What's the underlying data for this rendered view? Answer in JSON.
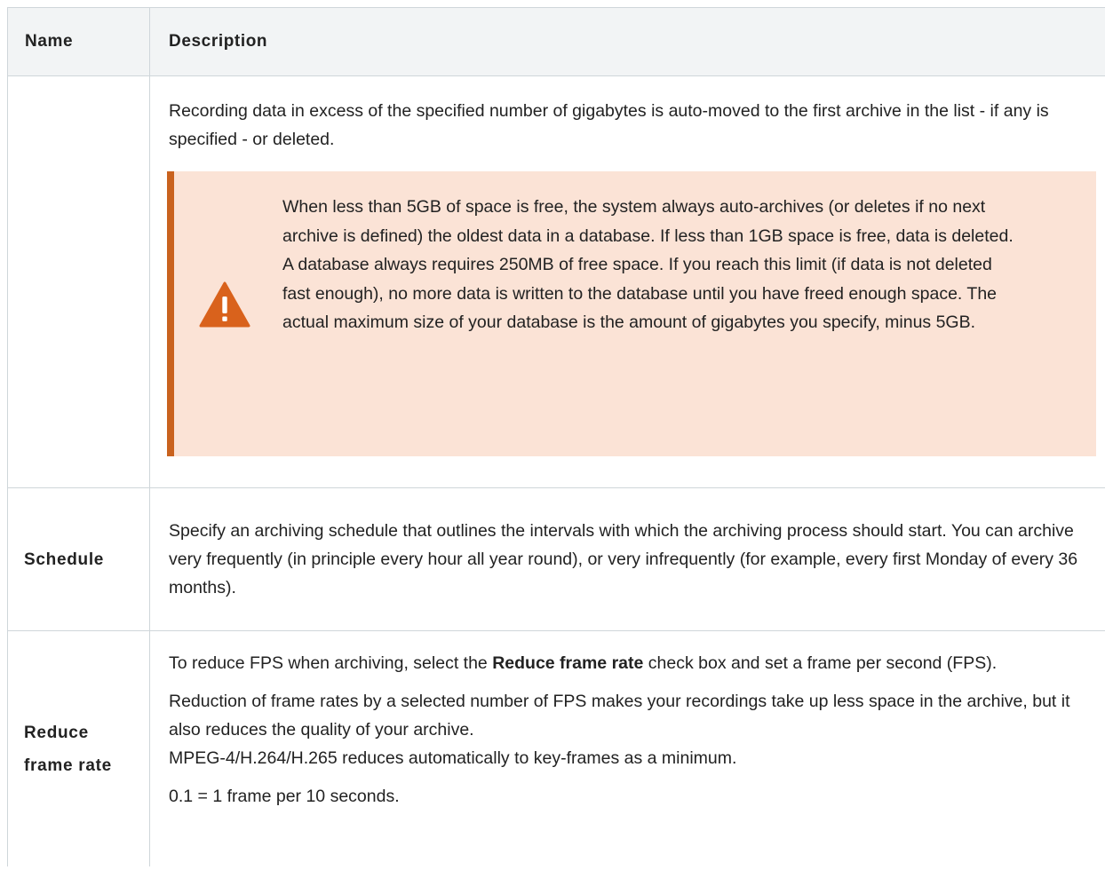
{
  "table": {
    "headers": {
      "name": "Name",
      "description": "Description"
    },
    "rows": [
      {
        "name": "",
        "paragraphs": [
          "Recording data in excess of the specified number of gigabytes is auto-moved to the first archive in the list - if any is specified - or deleted."
        ],
        "warning": {
          "icon": "warning-triangle-icon",
          "icon_color": "#d9621c",
          "accent_color": "#c9621e",
          "background": "#fbe3d6",
          "text": "When less than 5GB of space is free, the system always auto-archives (or deletes if no next archive is defined) the oldest data in a database. If less than 1GB space is free, data is deleted. A database always requires 250MB of free space. If you reach this limit (if data is not deleted fast enough), no more data is written to the database until you have freed enough space. The actual maximum size of your database is the amount of gigabytes you specify, minus 5GB."
        }
      },
      {
        "name": "Schedule",
        "paragraphs": [
          "Specify an archiving schedule that outlines the intervals with which the archiving process should start. You can archive very frequently (in principle every hour all year round), or very infrequently (for example, every first Monday of every 36 months)."
        ]
      },
      {
        "name": "Reduce frame rate",
        "p1": {
          "before": "To reduce FPS when archiving, select the ",
          "bold": "Reduce frame rate",
          "after": " check box and set a frame per second (FPS)."
        },
        "p2_line1": "Reduction of frame rates by a selected number of FPS makes your recordings take up less space in the archive, but it also reduces the quality of your archive.",
        "p2_line2": "MPEG-4/H.264/H.265 reduces automatically to key-frames as a minimum.",
        "p3": "0.1 = 1 frame per 10 seconds."
      }
    ]
  }
}
